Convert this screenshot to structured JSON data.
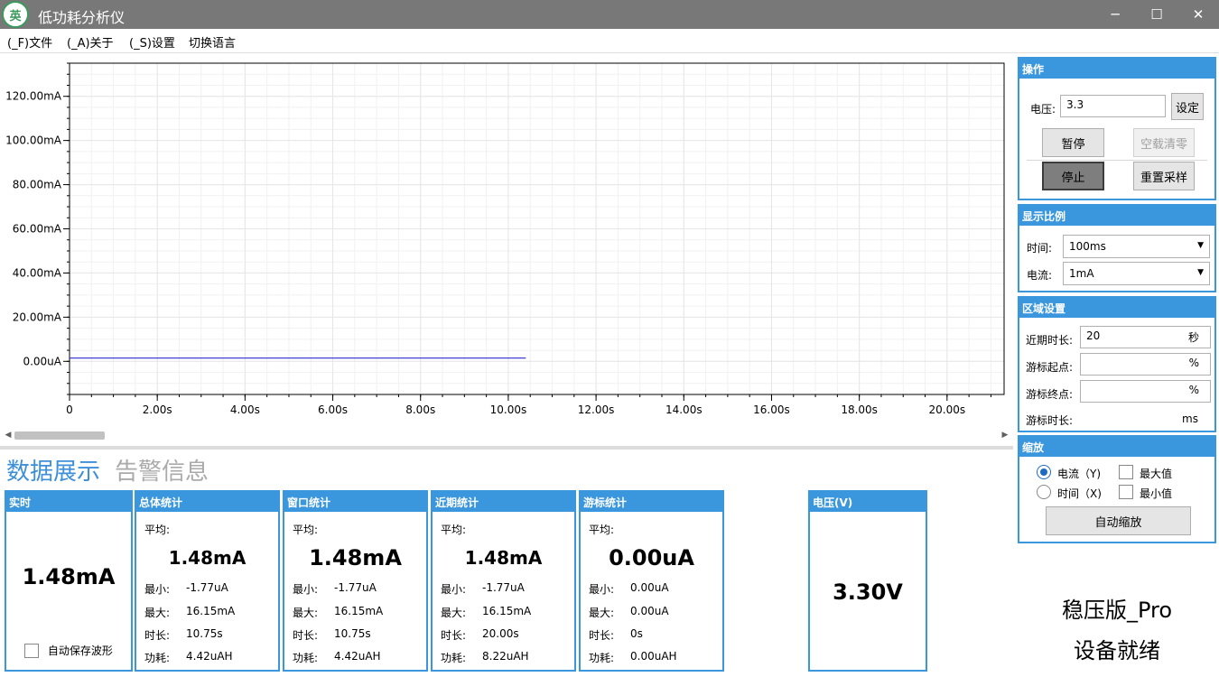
{
  "window": {
    "title": "低功耗分析仪",
    "logo_char": "英"
  },
  "menu": [
    "(_F)文件",
    "(_A)关于",
    "(_S)设置",
    "切换语言"
  ],
  "chart_data": {
    "type": "line",
    "y_ticks": [
      "120.00mA",
      "100.00mA",
      "80.00mA",
      "60.00mA",
      "40.00mA",
      "20.00mA",
      "0.00uA"
    ],
    "y_tick_values": [
      120,
      100,
      80,
      60,
      40,
      20,
      0
    ],
    "x_ticks": [
      "0",
      "2.00s",
      "4.00s",
      "6.00s",
      "8.00s",
      "10.00s",
      "12.00s",
      "14.00s",
      "16.00s",
      "18.00s",
      "20.00s"
    ],
    "x_tick_values": [
      0,
      2,
      4,
      6,
      8,
      10,
      12,
      14,
      16,
      18,
      20
    ],
    "xlim": [
      0,
      21.3
    ],
    "ylim": [
      -15,
      135
    ],
    "series": [
      {
        "x": [
          0,
          1,
          2,
          3,
          4,
          5,
          6,
          7,
          8,
          9,
          10,
          10.4
        ],
        "values": [
          1.48,
          1.48,
          1.48,
          1.48,
          1.48,
          1.48,
          1.48,
          1.48,
          1.48,
          1.48,
          1.48,
          1.48
        ],
        "color": "#2a2ad0"
      }
    ],
    "grid": true
  },
  "tabs": {
    "data": "数据展示",
    "alarm": "告警信息"
  },
  "realtime": {
    "title": "实时",
    "value": "1.48mA",
    "autosave": "自动保存波形"
  },
  "stats": [
    {
      "title": "总体统计",
      "avg_label": "平均:",
      "avg": "1.48mA",
      "min_label": "最小:",
      "min": "-1.77uA",
      "max_label": "最大:",
      "max": "16.15mA",
      "dur_label": "时长:",
      "dur": "10.75s",
      "pow_label": "功耗:",
      "pow": "4.42uAH"
    },
    {
      "title": "窗口统计",
      "avg_label": "平均:",
      "avg": "1.48mA",
      "min_label": "最小:",
      "min": "-1.77uA",
      "max_label": "最大:",
      "max": "16.15mA",
      "dur_label": "时长:",
      "dur": "10.75s",
      "pow_label": "功耗:",
      "pow": "4.42uAH"
    },
    {
      "title": "近期统计",
      "avg_label": "平均:",
      "avg": "1.48mA",
      "min_label": "最小:",
      "min": "-1.77uA",
      "max_label": "最大:",
      "max": "16.15mA",
      "dur_label": "时长:",
      "dur": "20.00s",
      "pow_label": "功耗:",
      "pow": "8.22uAH"
    },
    {
      "title": "游标统计",
      "avg_label": "平均:",
      "avg": "0.00uA",
      "min_label": "最小:",
      "min": "0.00uA",
      "max_label": "最大:",
      "max": "0.00uA",
      "dur_label": "时长:",
      "dur": "0s",
      "pow_label": "功耗:",
      "pow": "0.00uAH"
    }
  ],
  "voltage": {
    "title": "电压(V)",
    "value": "3.30V"
  },
  "operation": {
    "title": "操作",
    "voltage_label": "电压:",
    "voltage_value": "3.3",
    "set": "设定",
    "pause": "暂停",
    "zero": "空载清零",
    "stop": "停止",
    "resample": "重置采样"
  },
  "scale": {
    "title": "显示比例",
    "time_label": "时间:",
    "time_value": "100ms",
    "current_label": "电流:",
    "current_value": "1mA"
  },
  "region": {
    "title": "区域设置",
    "recent_label": "近期时长:",
    "recent_value": "20",
    "recent_unit": "秒",
    "start_label": "游标起点:",
    "start_unit": "%",
    "end_label": "游标终点:",
    "end_unit": "%",
    "cursor_label": "游标时长:",
    "cursor_unit": "ms"
  },
  "zoom": {
    "title": "缩放",
    "current_y": "电流（Y)",
    "time_x": "时间（X)",
    "max": "最大值",
    "min": "最小值",
    "auto": "自动缩放"
  },
  "status": {
    "edition": "稳压版_Pro",
    "state": "设备就绪"
  }
}
